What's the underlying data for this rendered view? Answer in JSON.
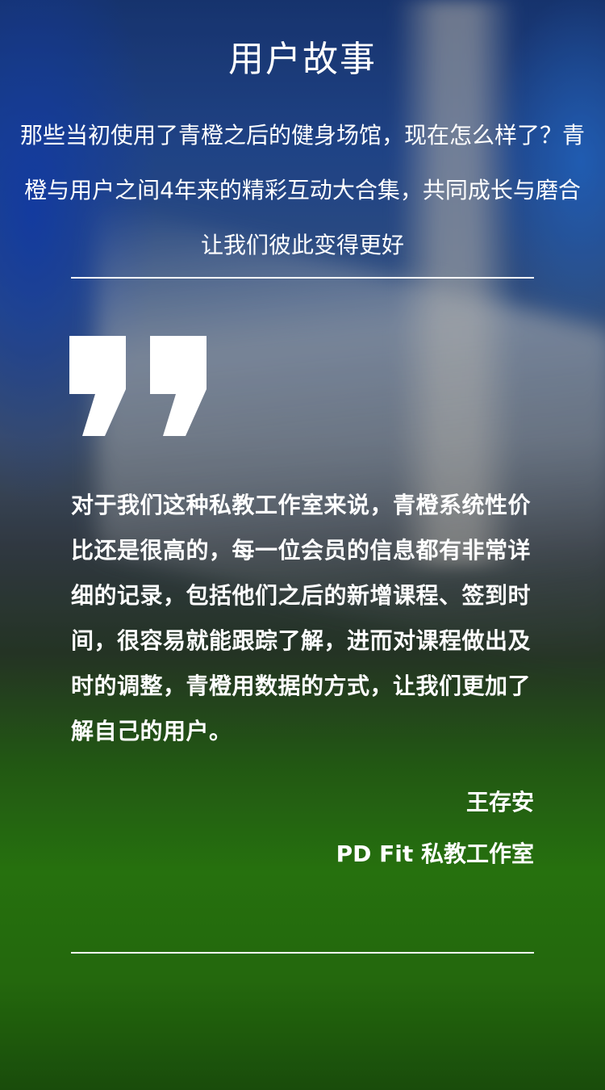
{
  "header": {
    "title": "用户故事",
    "intro": "那些当初使用了青橙之后的健身场馆，现在怎么样了？青橙与用户之间4年来的精彩互动大合集，共同成长与磨合让我们彼此变得更好"
  },
  "testimonial": {
    "quote": "对于我们这种私教工作室来说，青橙系统性价比还是很高的，每一位会员的信息都有非常详细的记录，包括他们之后的新增课程、签到时间，很容易就能跟踪了解，进而对课程做出及时的调整，青橙用数据的方式，让我们更加了解自己的用户。",
    "author": "王存安",
    "company": "PD Fit 私教工作室",
    "quote_icon": "closing-quote-icon"
  },
  "colors": {
    "text": "#ffffff",
    "divider": "#ffffff"
  }
}
